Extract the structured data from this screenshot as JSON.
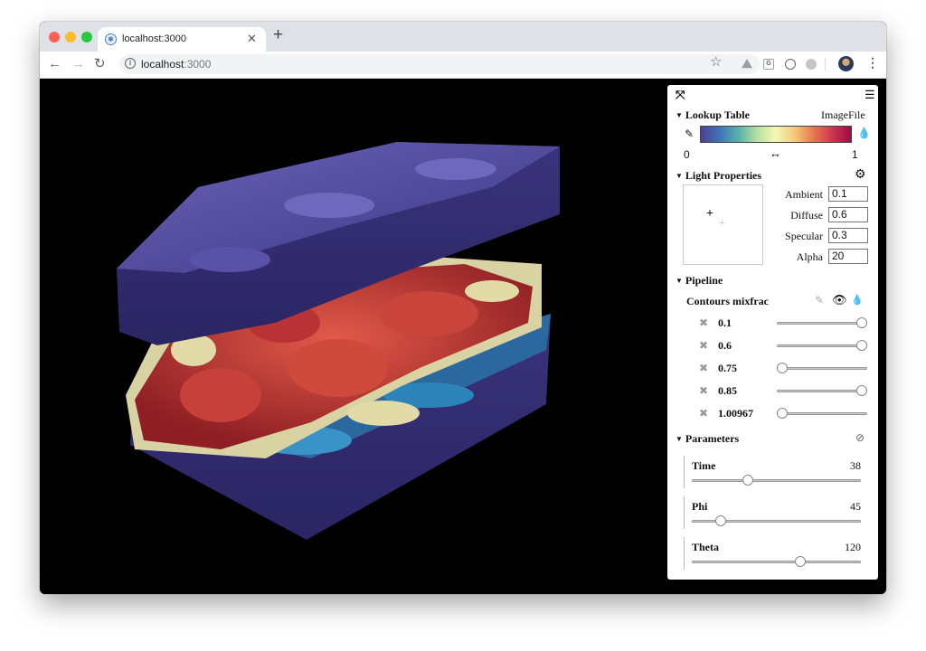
{
  "browser": {
    "tab_title": "localhost:3000",
    "url_host": "localhost",
    "url_port": ":3000",
    "icons": {
      "favicon": "atom-icon",
      "close": "close-icon",
      "new_tab": "plus-icon",
      "back": "arrow-left-icon",
      "forward": "arrow-right-icon",
      "reload": "reload-icon",
      "info": "info-icon",
      "bookmark": "star-icon",
      "menu": "kebab-menu-icon"
    }
  },
  "panel": {
    "lookup_table": {
      "title": "Lookup Table",
      "preset": "ImageFile",
      "min": "0",
      "max": "1",
      "range_icon": "↔"
    },
    "light": {
      "title": "Light Properties",
      "fields": [
        {
          "label": "Ambient",
          "value": "0.1"
        },
        {
          "label": "Diffuse",
          "value": "0.6"
        },
        {
          "label": "Specular",
          "value": "0.3"
        },
        {
          "label": "Alpha",
          "value": "20"
        }
      ]
    },
    "pipeline": {
      "title": "Pipeline",
      "item_label": "Contours mixfrac",
      "contours": [
        {
          "value": "0.1",
          "level": 1.0
        },
        {
          "value": "0.6",
          "level": 1.0
        },
        {
          "value": "0.75",
          "level": 0.0
        },
        {
          "value": "0.85",
          "level": 1.0
        },
        {
          "value": "1.00967",
          "level": 0.0
        }
      ]
    },
    "parameters": {
      "title": "Parameters",
      "items": [
        {
          "label": "Time",
          "value": "38",
          "level": 0.32
        },
        {
          "label": "Phi",
          "value": "45",
          "level": 0.15
        },
        {
          "label": "Theta",
          "value": "120",
          "level": 0.65
        }
      ]
    }
  }
}
